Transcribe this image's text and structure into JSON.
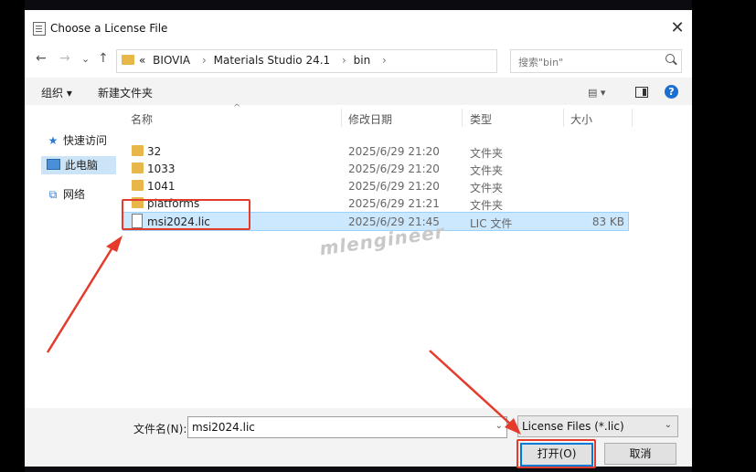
{
  "dialog": {
    "title": "Choose a License File",
    "close_glyph": "✕"
  },
  "nav": {
    "back": "←",
    "forward": "→",
    "recent": "⌄",
    "up": "↑",
    "prefix": "«",
    "path": [
      "BIOVIA",
      "Materials Studio 24.1",
      "bin"
    ],
    "path_sep": "›",
    "dropdown": "⌄",
    "refresh": "↻",
    "search_placeholder": "搜索\"bin\""
  },
  "toolbar": {
    "organize": "组织 ▾",
    "new_folder": "新建文件夹",
    "view_glyph": "▤ ▾",
    "help": "?"
  },
  "sidebar": {
    "items": [
      {
        "label": "快速访问",
        "icon": "star-icon"
      },
      {
        "label": "此电脑",
        "icon": "computer-icon"
      },
      {
        "label": "网络",
        "icon": "network-icon"
      }
    ]
  },
  "columns": {
    "name": "名称",
    "date": "修改日期",
    "type": "类型",
    "size": "大小",
    "sort_glyph": "^"
  },
  "files": [
    {
      "name": "32",
      "date": "2025/6/29 21:20",
      "type": "文件夹",
      "size": "",
      "kind": "folder"
    },
    {
      "name": "1033",
      "date": "2025/6/29 21:20",
      "type": "文件夹",
      "size": "",
      "kind": "folder"
    },
    {
      "name": "1041",
      "date": "2025/6/29 21:20",
      "type": "文件夹",
      "size": "",
      "kind": "folder"
    },
    {
      "name": "platforms",
      "date": "2025/6/29 21:21",
      "type": "文件夹",
      "size": "",
      "kind": "folder"
    },
    {
      "name": "msi2024.lic",
      "date": "2025/6/29 21:45",
      "type": "LIC 文件",
      "size": "83 KB",
      "kind": "file"
    }
  ],
  "watermark": "mlengineer",
  "bottom": {
    "filename_label": "文件名(N):",
    "filename_value": "msi2024.lic",
    "dropdown": "⌄",
    "filter_value": "License Files (*.lic)",
    "open_label": "打开(O)",
    "cancel_label": "取消"
  },
  "colors": {
    "highlight": "#e43b2c",
    "selection": "#cce8ff",
    "accent": "#0078d7"
  }
}
